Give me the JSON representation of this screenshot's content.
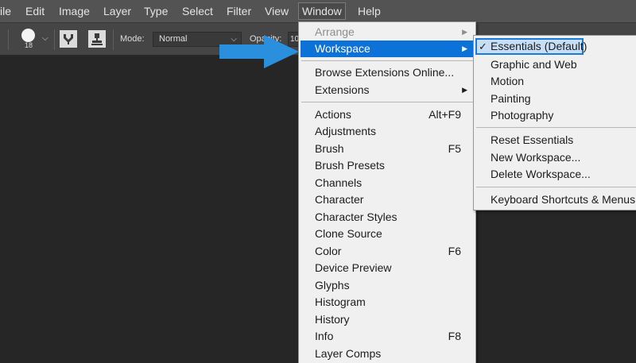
{
  "menubar": {
    "items": [
      {
        "label": "ile"
      },
      {
        "label": "Edit"
      },
      {
        "label": "Image"
      },
      {
        "label": "Layer"
      },
      {
        "label": "Type"
      },
      {
        "label": "Select"
      },
      {
        "label": "Filter"
      },
      {
        "label": "View"
      },
      {
        "label": "Window"
      },
      {
        "label": "Help"
      }
    ]
  },
  "options": {
    "brush_size": "18",
    "mode_label": "Mode:",
    "mode_value": "Normal",
    "opacity_label": "Opacity:",
    "opacity_value": "10"
  },
  "window_menu": {
    "arrange": "Arrange",
    "workspace": "Workspace",
    "browse_extensions": "Browse Extensions Online...",
    "extensions": "Extensions",
    "items": [
      {
        "label": "Actions",
        "shortcut": "Alt+F9"
      },
      {
        "label": "Adjustments",
        "shortcut": ""
      },
      {
        "label": "Brush",
        "shortcut": "F5"
      },
      {
        "label": "Brush Presets",
        "shortcut": ""
      },
      {
        "label": "Channels",
        "shortcut": ""
      },
      {
        "label": "Character",
        "shortcut": ""
      },
      {
        "label": "Character Styles",
        "shortcut": ""
      },
      {
        "label": "Clone Source",
        "shortcut": ""
      },
      {
        "label": "Color",
        "shortcut": "F6"
      },
      {
        "label": "Device Preview",
        "shortcut": ""
      },
      {
        "label": "Glyphs",
        "shortcut": ""
      },
      {
        "label": "Histogram",
        "shortcut": ""
      },
      {
        "label": "History",
        "shortcut": ""
      },
      {
        "label": "Info",
        "shortcut": "F8"
      },
      {
        "label": "Layer Comps",
        "shortcut": ""
      }
    ]
  },
  "workspace_menu": {
    "check_glyph": "✓",
    "essentials": "Essentials (Default)",
    "graphic_web": "Graphic and Web",
    "motion": "Motion",
    "painting": "Painting",
    "photography": "Photography",
    "reset": "Reset Essentials",
    "new": "New Workspace...",
    "delete": "Delete Workspace...",
    "keyboard": "Keyboard Shortcuts & Menus..."
  },
  "colors": {
    "highlight": "#0c72d8",
    "arrow": "#2a8fdc",
    "selected_outline": "#1a7ad6"
  }
}
